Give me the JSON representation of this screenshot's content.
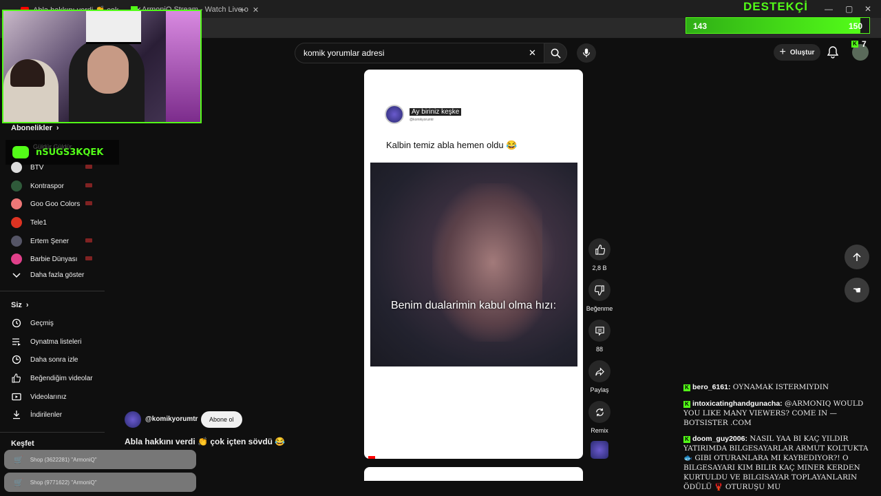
{
  "browser": {
    "tabs": [
      {
        "label": "Abla hakkını verdi 👏 çok"
      },
      {
        "label": "ArmoniQ Stream - Watch Live o"
      }
    ],
    "new_tab": "+"
  },
  "overlay": {
    "goal_title": "DESTEKÇİ",
    "goal_current": "143",
    "goal_target": "150",
    "goal_progress": 0.953,
    "goal_color": "#53fc18",
    "k_count": "7",
    "discord_name": "nSUGS3KQEK"
  },
  "header": {
    "search_value": "komik yorumlar adresi",
    "create_label": "Oluştur"
  },
  "sidebar": {
    "subscriptions_title": "Abonelikler",
    "sub_hidden": "Güldür Güldür",
    "channels": [
      {
        "name": "BTV",
        "color": "#ddd",
        "live": true
      },
      {
        "name": "Kontraspor",
        "color": "#2f5a3a",
        "live": true
      },
      {
        "name": "Goo Goo Colors",
        "color": "#e77",
        "live": true
      },
      {
        "name": "Tele1",
        "color": "#d32",
        "live": false
      },
      {
        "name": "Ertem Şener",
        "color": "#556",
        "live": true
      },
      {
        "name": "Barbie Dünyası",
        "color": "#e0408a",
        "live": true
      }
    ],
    "show_more": "Daha fazla göster",
    "you_title": "Siz",
    "you_items": [
      {
        "label": "Geçmiş",
        "icon": "history-icon"
      },
      {
        "label": "Oynatma listeleri",
        "icon": "playlist-icon"
      },
      {
        "label": "Daha sonra izle",
        "icon": "clock-icon"
      },
      {
        "label": "Beğendiğim videolar",
        "icon": "like-icon"
      },
      {
        "label": "Videolarınız",
        "icon": "video-icon"
      },
      {
        "label": "İndirilenler",
        "icon": "download-icon"
      }
    ],
    "explore_title": "Keşfet"
  },
  "short": {
    "post_author": "Ay biriniz keşke",
    "post_handle": "@komikyorumtr",
    "post_text": "Kalbin temiz abla hemen oldu 😂",
    "video_caption": "Benim dualarimin kabul olma hızı:",
    "channel_handle": "@komikyorumtr",
    "subscribe_label": "Abone ol",
    "title": "Abla hakkını verdi 👏 çok içten sövdü 😂",
    "likes": "2,8 B",
    "dislike_label": "Beğenme",
    "comments": "88",
    "share_label": "Paylaş",
    "remix_label": "Remix"
  },
  "chat": [
    {
      "user": "bero_6161:",
      "text": "OYNAMAK ISTERMIYDIN"
    },
    {
      "user": "intoxicatinghandgunacha:",
      "text": "@ARMONIQ WOULD YOU LIKE MANY VIEWERS? COME IN — BOTSISTER .COM"
    },
    {
      "user": "doom_guy2006:",
      "text": "NASIL YAA BI KAÇ YILDIR YATIRIMDA BILGESAYARLAR ARMUT KOLTUKTA 🐟 GIBI OTURANLARA MI KAYBEDIYOR?! O BILGESAYARI KIM BILIR KAÇ MINER KERDEN KURTULDU VE BILGISAYAR TOPLAYANLARIN ÖDÜLÜ 🦞 OTURUŞU MU"
    }
  ],
  "shop_notices": [
    {
      "text": "Shop (3622281) \"ArmoniQ\""
    },
    {
      "text": "Shop (9771622) \"ArmoniQ\""
    }
  ]
}
